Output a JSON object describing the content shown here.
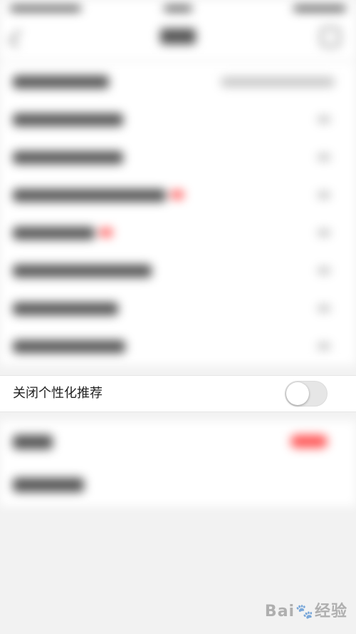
{
  "focus_row": {
    "label": "关闭个性化推荐",
    "toggle_on": false
  },
  "watermark": {
    "brand_left": "Bai",
    "paw": "🐾",
    "brand_right": "经验"
  },
  "colors": {
    "background": "#f2f2f2",
    "row_background": "#ffffff",
    "toggle_off": "#e6e6e6",
    "accent_red": "#ff5555",
    "text": "#222222"
  },
  "icons": [
    "back-arrow-icon",
    "share-icon",
    "chevron-right-icon"
  ]
}
